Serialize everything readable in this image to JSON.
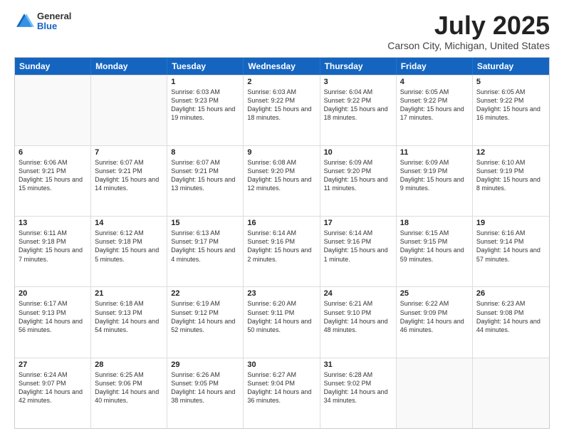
{
  "logo": {
    "line1": "General",
    "line2": "Blue"
  },
  "title": "July 2025",
  "subtitle": "Carson City, Michigan, United States",
  "days_of_week": [
    "Sunday",
    "Monday",
    "Tuesday",
    "Wednesday",
    "Thursday",
    "Friday",
    "Saturday"
  ],
  "weeks": [
    [
      {
        "day": "",
        "empty": true
      },
      {
        "day": "",
        "empty": true
      },
      {
        "day": "1",
        "sunrise": "6:03 AM",
        "sunset": "9:23 PM",
        "daylight": "15 hours and 19 minutes."
      },
      {
        "day": "2",
        "sunrise": "6:03 AM",
        "sunset": "9:22 PM",
        "daylight": "15 hours and 18 minutes."
      },
      {
        "day": "3",
        "sunrise": "6:04 AM",
        "sunset": "9:22 PM",
        "daylight": "15 hours and 18 minutes."
      },
      {
        "day": "4",
        "sunrise": "6:05 AM",
        "sunset": "9:22 PM",
        "daylight": "15 hours and 17 minutes."
      },
      {
        "day": "5",
        "sunrise": "6:05 AM",
        "sunset": "9:22 PM",
        "daylight": "15 hours and 16 minutes."
      }
    ],
    [
      {
        "day": "6",
        "sunrise": "6:06 AM",
        "sunset": "9:21 PM",
        "daylight": "15 hours and 15 minutes."
      },
      {
        "day": "7",
        "sunrise": "6:07 AM",
        "sunset": "9:21 PM",
        "daylight": "15 hours and 14 minutes."
      },
      {
        "day": "8",
        "sunrise": "6:07 AM",
        "sunset": "9:21 PM",
        "daylight": "15 hours and 13 minutes."
      },
      {
        "day": "9",
        "sunrise": "6:08 AM",
        "sunset": "9:20 PM",
        "daylight": "15 hours and 12 minutes."
      },
      {
        "day": "10",
        "sunrise": "6:09 AM",
        "sunset": "9:20 PM",
        "daylight": "15 hours and 11 minutes."
      },
      {
        "day": "11",
        "sunrise": "6:09 AM",
        "sunset": "9:19 PM",
        "daylight": "15 hours and 9 minutes."
      },
      {
        "day": "12",
        "sunrise": "6:10 AM",
        "sunset": "9:19 PM",
        "daylight": "15 hours and 8 minutes."
      }
    ],
    [
      {
        "day": "13",
        "sunrise": "6:11 AM",
        "sunset": "9:18 PM",
        "daylight": "15 hours and 7 minutes."
      },
      {
        "day": "14",
        "sunrise": "6:12 AM",
        "sunset": "9:18 PM",
        "daylight": "15 hours and 5 minutes."
      },
      {
        "day": "15",
        "sunrise": "6:13 AM",
        "sunset": "9:17 PM",
        "daylight": "15 hours and 4 minutes."
      },
      {
        "day": "16",
        "sunrise": "6:14 AM",
        "sunset": "9:16 PM",
        "daylight": "15 hours and 2 minutes."
      },
      {
        "day": "17",
        "sunrise": "6:14 AM",
        "sunset": "9:16 PM",
        "daylight": "15 hours and 1 minute."
      },
      {
        "day": "18",
        "sunrise": "6:15 AM",
        "sunset": "9:15 PM",
        "daylight": "14 hours and 59 minutes."
      },
      {
        "day": "19",
        "sunrise": "6:16 AM",
        "sunset": "9:14 PM",
        "daylight": "14 hours and 57 minutes."
      }
    ],
    [
      {
        "day": "20",
        "sunrise": "6:17 AM",
        "sunset": "9:13 PM",
        "daylight": "14 hours and 56 minutes."
      },
      {
        "day": "21",
        "sunrise": "6:18 AM",
        "sunset": "9:13 PM",
        "daylight": "14 hours and 54 minutes."
      },
      {
        "day": "22",
        "sunrise": "6:19 AM",
        "sunset": "9:12 PM",
        "daylight": "14 hours and 52 minutes."
      },
      {
        "day": "23",
        "sunrise": "6:20 AM",
        "sunset": "9:11 PM",
        "daylight": "14 hours and 50 minutes."
      },
      {
        "day": "24",
        "sunrise": "6:21 AM",
        "sunset": "9:10 PM",
        "daylight": "14 hours and 48 minutes."
      },
      {
        "day": "25",
        "sunrise": "6:22 AM",
        "sunset": "9:09 PM",
        "daylight": "14 hours and 46 minutes."
      },
      {
        "day": "26",
        "sunrise": "6:23 AM",
        "sunset": "9:08 PM",
        "daylight": "14 hours and 44 minutes."
      }
    ],
    [
      {
        "day": "27",
        "sunrise": "6:24 AM",
        "sunset": "9:07 PM",
        "daylight": "14 hours and 42 minutes."
      },
      {
        "day": "28",
        "sunrise": "6:25 AM",
        "sunset": "9:06 PM",
        "daylight": "14 hours and 40 minutes."
      },
      {
        "day": "29",
        "sunrise": "6:26 AM",
        "sunset": "9:05 PM",
        "daylight": "14 hours and 38 minutes."
      },
      {
        "day": "30",
        "sunrise": "6:27 AM",
        "sunset": "9:04 PM",
        "daylight": "14 hours and 36 minutes."
      },
      {
        "day": "31",
        "sunrise": "6:28 AM",
        "sunset": "9:02 PM",
        "daylight": "14 hours and 34 minutes."
      },
      {
        "day": "",
        "empty": true
      },
      {
        "day": "",
        "empty": true
      }
    ]
  ]
}
